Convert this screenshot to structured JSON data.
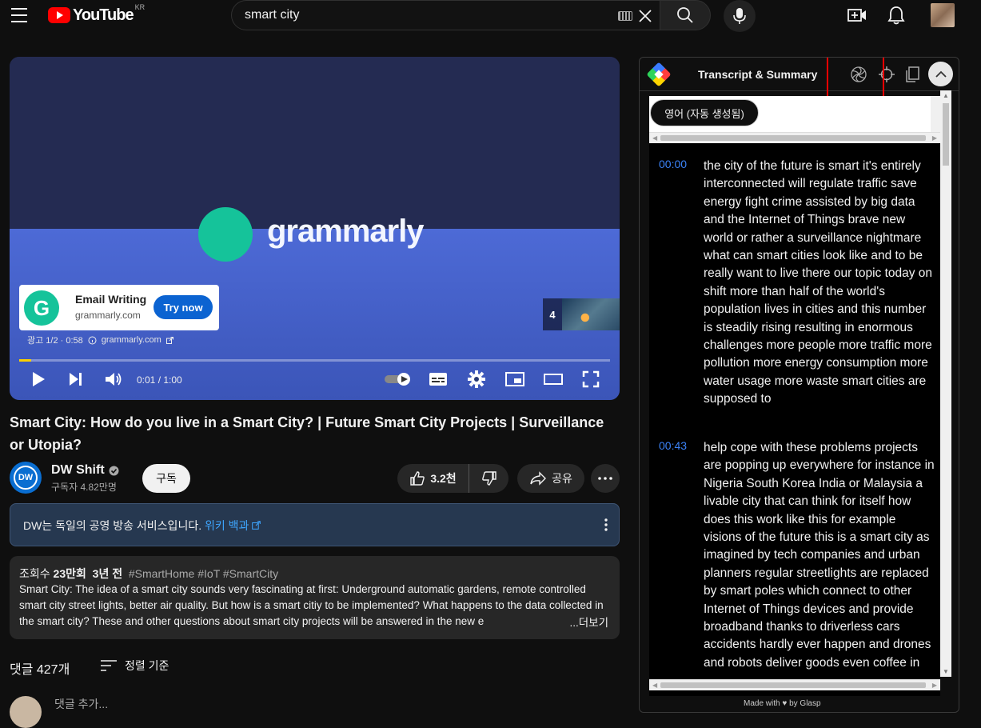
{
  "topbar": {
    "logo_text": "YouTube",
    "country_code": "KR",
    "search_value": "smart city"
  },
  "player": {
    "ad_brand": "grammarly",
    "ad_card_title": "Email Writing",
    "ad_card_domain": "grammarly.com",
    "ad_card_cta": "Try now",
    "ad_info_counter": "광고 1/2 · 0:58",
    "ad_info_domain": "grammarly.com",
    "ad_thumb_number": "4",
    "time": "0:01 / 1:00",
    "progress_fraction": 0.02
  },
  "video": {
    "title": "Smart City: How do you live in a Smart City? | Future Smart City Projects | Surveillance or Utopia?",
    "channel_name": "DW Shift",
    "channel_avatar_text": "DW",
    "subscribers": "구독자 4.82만명",
    "subscribe_label": "구독",
    "likes": "3.2천",
    "share_label": "공유"
  },
  "info_panel": {
    "text": "DW는 독일의 공영 방송 서비스입니다.",
    "link": "위키 백과"
  },
  "description": {
    "views_label": "조회수",
    "views": "23만회",
    "age": "3년 전",
    "tags": "#SmartHome #IoT #SmartCity",
    "body": "Smart City: The idea of a smart city sounds very fascinating at first: Underground automatic gardens, remote controlled smart city street lights, better air quality. But how is a smart citiy to be implemented? What happens to the data collected in the smart city? These and other questions about smart city projects will be answered in the new e",
    "more": "...더보기"
  },
  "comments": {
    "count": "댓글 427개",
    "sort_label": "정렬 기준",
    "add_placeholder": "댓글 추가..."
  },
  "extension": {
    "title": "Transcript & Summary",
    "language": "영어 (자동 생성됨)",
    "segments": [
      {
        "time": "00:00",
        "text": "the city of the future is smart it's entirely interconnected will regulate traffic save energy fight crime assisted by big data and the Internet of Things brave new world or rather a surveillance nightmare what can smart cities look like and to be really want to live there our topic today on shift more than half of the world's population lives in cities and this number is steadily rising resulting in enormous challenges more people more traffic more pollution more energy consumption more water usage more waste smart cities are supposed to"
      },
      {
        "time": "00:43",
        "text": "help cope with these problems projects are popping up everywhere for instance in Nigeria South Korea India or Malaysia a livable city that can think for itself how does this work like this for example visions of the future this is a smart city as imagined by tech companies and urban planners regular streetlights are replaced by smart poles which connect to other Internet of Things devices and provide broadband thanks to driverless cars accidents hardly ever happen and drones and robots deliver goods even coffee in"
      }
    ],
    "footer": "Made with ♥ by Glasp"
  },
  "colors": {
    "youtube_red": "#ff0000",
    "link_blue": "#3ea6ff",
    "timestamp_blue": "#3b82f6",
    "grammarly_green": "#15c39a",
    "highlight_red": "#ff0000"
  }
}
